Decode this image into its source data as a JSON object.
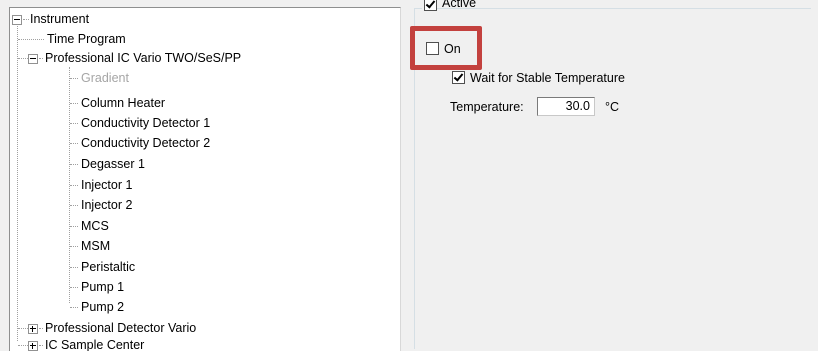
{
  "tree": {
    "root": {
      "label": "Instrument",
      "expander": "minus"
    },
    "items": [
      {
        "label": "Time Program"
      },
      {
        "label": "Professional IC Vario TWO/SeS/PP",
        "expander": "minus"
      },
      {
        "label": "Gradient",
        "disabled": true
      },
      {
        "label": "Column Heater"
      },
      {
        "label": "Conductivity Detector 1"
      },
      {
        "label": "Conductivity Detector 2"
      },
      {
        "label": "Degasser 1"
      },
      {
        "label": "Injector 1"
      },
      {
        "label": "Injector 2"
      },
      {
        "label": "MCS"
      },
      {
        "label": "MSM"
      },
      {
        "label": "Peristaltic"
      },
      {
        "label": "Pump 1"
      },
      {
        "label": "Pump 2"
      },
      {
        "label": "Professional Detector Vario",
        "expander": "plus"
      },
      {
        "label": "IC Sample Center",
        "expander": "plus"
      }
    ]
  },
  "settings": {
    "active_label": "Active",
    "active_checked": true,
    "on_label": "On",
    "on_checked": false,
    "wait_label": "Wait for Stable Temperature",
    "wait_checked": true,
    "temperature_label": "Temperature:",
    "temperature_value": "30.0",
    "temperature_unit": "°C"
  },
  "colors": {
    "highlight": "#c3413e"
  }
}
